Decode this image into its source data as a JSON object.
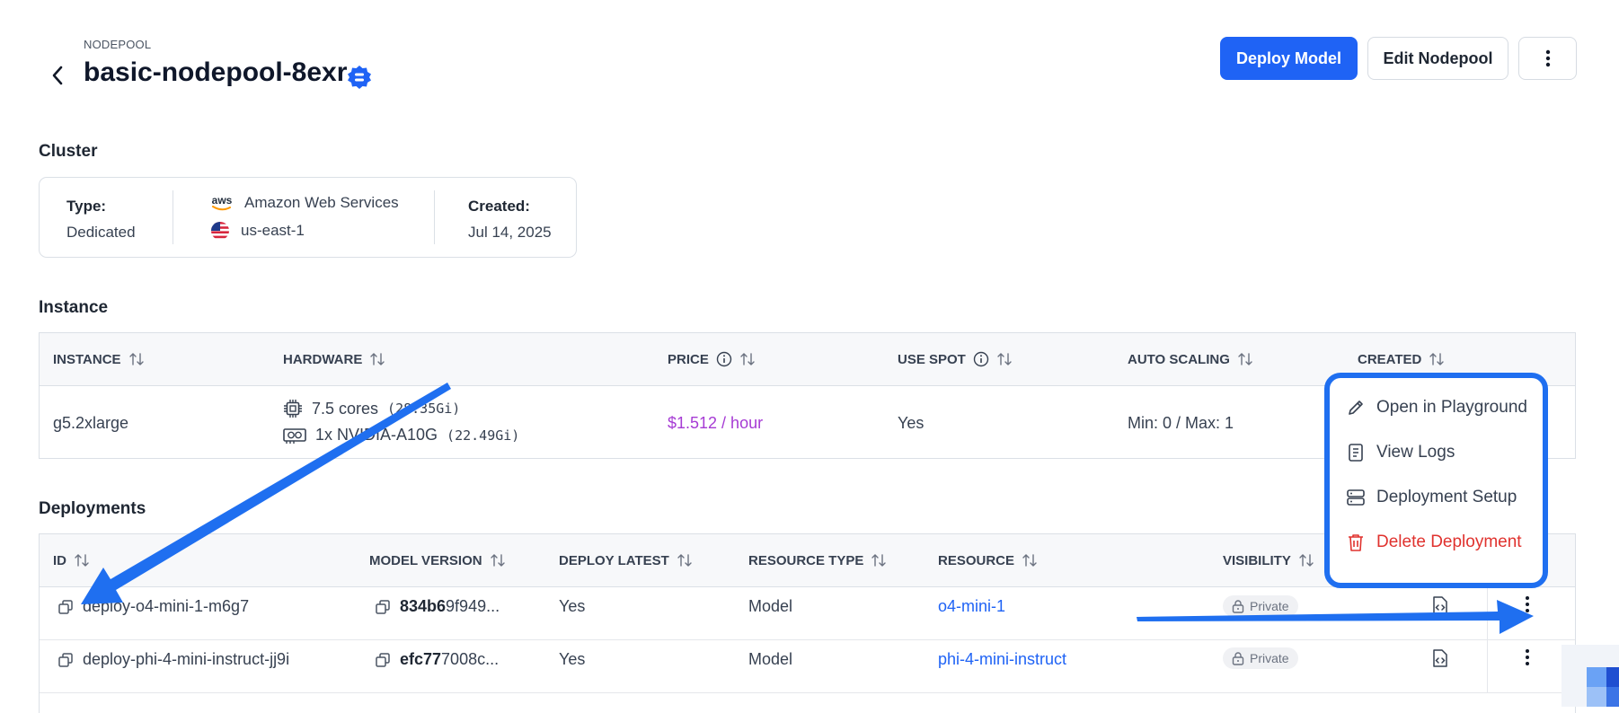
{
  "header": {
    "eyebrow": "NODEPOOL",
    "title": "basic-nodepool-8exr",
    "deploy_label": "Deploy Model",
    "edit_label": "Edit Nodepool"
  },
  "cluster": {
    "section_title": "Cluster",
    "type_label": "Type:",
    "type_value": "Dedicated",
    "provider_logo": "aws",
    "provider": "Amazon Web Services",
    "region": "us-east-1",
    "created_label": "Created:",
    "created_value": "Jul 14, 2025"
  },
  "instance": {
    "section_title": "Instance",
    "columns": [
      "INSTANCE",
      "HARDWARE",
      "PRICE",
      "USE SPOT",
      "AUTO SCALING",
      "CREATED"
    ],
    "row": {
      "instance": "g5.2xlarge",
      "cpu": "7.5 cores",
      "cpu_mem": "(28.35Gi)",
      "gpu": "1x NVIDIA-A10G",
      "gpu_mem": "(22.49Gi)",
      "price": "$1.512 / hour",
      "use_spot": "Yes",
      "auto_scaling": "Min: 0 / Max: 1"
    }
  },
  "deployments": {
    "section_title": "Deployments",
    "columns": [
      "ID",
      "MODEL VERSION",
      "DEPLOY LATEST",
      "RESOURCE TYPE",
      "RESOURCE",
      "VISIBILITY"
    ],
    "rows": [
      {
        "id": "deploy-o4-mini-1-m6g7",
        "version_bold": "834b6",
        "version_rest": "9f949...",
        "deploy_latest": "Yes",
        "resource_type": "Model",
        "resource": "o4-mini-1",
        "visibility": "Private"
      },
      {
        "id": "deploy-phi-4-mini-instruct-jj9i",
        "version_bold": "efc77",
        "version_rest": "7008c...",
        "deploy_latest": "Yes",
        "resource_type": "Model",
        "resource": "phi-4-mini-instruct",
        "visibility": "Private"
      }
    ]
  },
  "context_menu": {
    "items": [
      {
        "label": "Open in Playground",
        "icon": "pencil-icon"
      },
      {
        "label": "View Logs",
        "icon": "document-icon"
      },
      {
        "label": "Deployment Setup",
        "icon": "server-icon"
      },
      {
        "label": "Delete Deployment",
        "icon": "trash-icon"
      }
    ]
  },
  "colors": {
    "primary": "#1f63f5",
    "price": "#a63bd4",
    "danger": "#e0322e",
    "annotation": "#1f6ff0"
  }
}
